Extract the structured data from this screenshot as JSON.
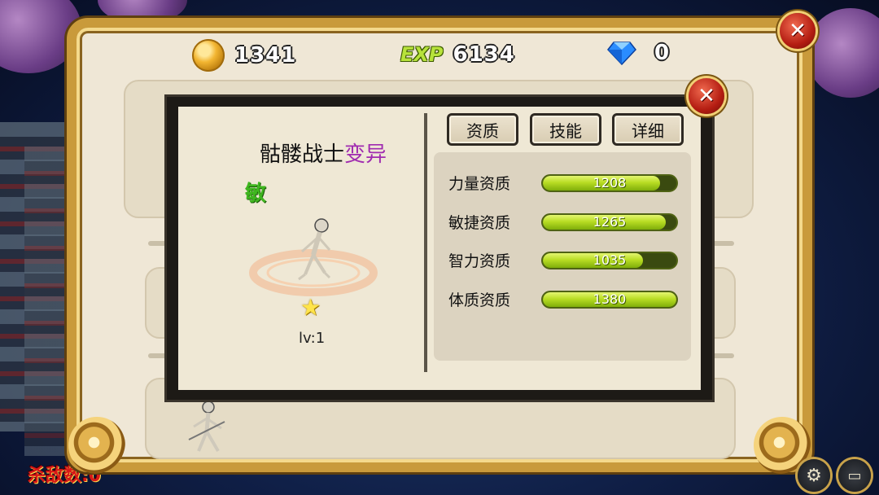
{
  "resources": {
    "gold": "1341",
    "exp_label": "EXP",
    "exp": "6134",
    "gems": "0"
  },
  "dialog": {
    "character": {
      "name": "骷髅战士",
      "mutation": "变异",
      "type": "敏",
      "level": "lv:1"
    },
    "tabs": [
      "资质",
      "技能",
      "详细"
    ],
    "aptitudes": [
      {
        "label": "力量资质",
        "value": "1208",
        "fill": 0.88
      },
      {
        "label": "敏捷资质",
        "value": "1265",
        "fill": 0.92
      },
      {
        "label": "智力资质",
        "value": "1035",
        "fill": 0.75
      },
      {
        "label": "体质资质",
        "value": "1380",
        "fill": 1.0
      }
    ]
  },
  "hud": {
    "kill_counter": "杀敌数:0"
  },
  "colors": {
    "frame_gold": "#c99a3b",
    "panel_bg": "#efe7d6",
    "mutation_purple": "#a02bb0",
    "type_green": "#3fb61f",
    "bar_green": "#b9dd24",
    "close_red": "#b41d12"
  },
  "icons": {
    "gold": "gold-coin-icon",
    "gem": "diamond-icon",
    "close": "close-x-icon",
    "star": "star-icon",
    "settings": "gear-icon",
    "menu": "computer-icon"
  }
}
